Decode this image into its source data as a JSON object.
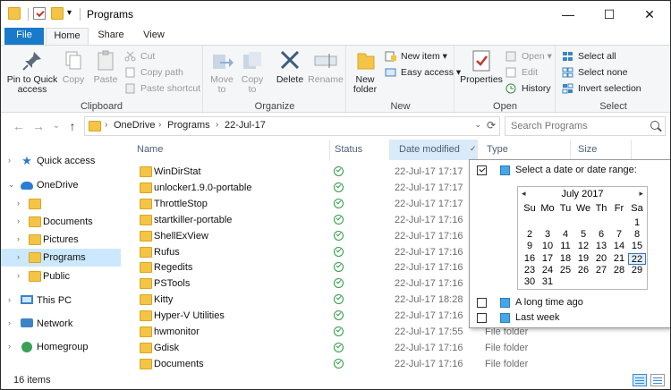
{
  "window": {
    "title": "Programs",
    "controls": {
      "minimize": "—",
      "maximize": "☐",
      "close": "✕"
    },
    "qa_dropdown": "▾"
  },
  "ribbon": {
    "tabs": [
      "File",
      "Home",
      "Share",
      "View"
    ],
    "clipboard": {
      "label": "Clipboard",
      "pin": "Pin to Quick access",
      "copy": "Copy",
      "paste": "Paste",
      "cut": "Cut",
      "copy_path": "Copy path",
      "paste_shortcut": "Paste shortcut"
    },
    "organize": {
      "label": "Organize",
      "move_to": "Move to",
      "copy_to": "Copy to",
      "delete": "Delete",
      "rename": "Rename"
    },
    "new": {
      "label": "New",
      "new_folder": "New folder",
      "new_item": "New item ▾",
      "easy_access": "Easy access ▾"
    },
    "open": {
      "label": "Open",
      "properties": "Properties",
      "open": "Open ▾",
      "edit": "Edit",
      "history": "History"
    },
    "select": {
      "label": "Select",
      "select_all": "Select all",
      "select_none": "Select none",
      "invert": "Invert selection"
    }
  },
  "address": {
    "crumbs": [
      "OneDrive",
      "Programs",
      "22-Jul-17"
    ],
    "back": "←",
    "forward": "→",
    "recent": "⌄",
    "up": "↑",
    "dropdown": "⌄",
    "refresh": "⟳",
    "chevron": "›"
  },
  "search": {
    "placeholder": "Search Programs"
  },
  "nav": {
    "items": [
      "Quick access",
      "OneDrive",
      "",
      "Documents",
      "Pictures",
      "Programs",
      "Public",
      "This PC",
      "Network",
      "Homegroup"
    ]
  },
  "columns": {
    "name": "Name",
    "status": "Status",
    "date": "Date modified",
    "type": "Type",
    "size": "Size",
    "sort_arrow": "✓"
  },
  "files": [
    {
      "name": "WinDirStat",
      "date": "22-Jul-17 17:17",
      "type": ""
    },
    {
      "name": "unlocker1.9.0-portable",
      "date": "22-Jul-17 17:17",
      "type": ""
    },
    {
      "name": "ThrottleStop",
      "date": "22-Jul-17 17:17",
      "type": ""
    },
    {
      "name": "startkiller-portable",
      "date": "22-Jul-17 17:16",
      "type": ""
    },
    {
      "name": "ShellExView",
      "date": "22-Jul-17 17:16",
      "type": ""
    },
    {
      "name": "Rufus",
      "date": "22-Jul-17 17:16",
      "type": ""
    },
    {
      "name": "Regedits",
      "date": "22-Jul-17 17:16",
      "type": ""
    },
    {
      "name": "PSTools",
      "date": "22-Jul-17 17:16",
      "type": ""
    },
    {
      "name": "Kitty",
      "date": "22-Jul-17 18:28",
      "type": ""
    },
    {
      "name": "Hyper-V Utilities",
      "date": "22-Jul-17 17:16",
      "type": ""
    },
    {
      "name": "hwmonitor",
      "date": "22-Jul-17 17:55",
      "type": "File folder"
    },
    {
      "name": "Gdisk",
      "date": "22-Jul-17 17:16",
      "type": "File folder"
    },
    {
      "name": "Documents",
      "date": "22-Jul-17 17:16",
      "type": "File folder"
    }
  ],
  "filter_popup": {
    "select_date": "Select a date or date range:",
    "month": "July 2017",
    "prev": "◂",
    "next": "▸",
    "weekdays": [
      "Su",
      "Mo",
      "Tu",
      "We",
      "Th",
      "Fr",
      "Sa"
    ],
    "weeks": [
      [
        "",
        "",
        "",
        "",
        "",
        "",
        "1"
      ],
      [
        "2",
        "3",
        "4",
        "5",
        "6",
        "7",
        "8"
      ],
      [
        "9",
        "10",
        "11",
        "12",
        "13",
        "14",
        "15"
      ],
      [
        "16",
        "17",
        "18",
        "19",
        "20",
        "21",
        "22"
      ],
      [
        "23",
        "24",
        "25",
        "26",
        "27",
        "28",
        "29"
      ],
      [
        "30",
        "31",
        "",
        "",
        "",
        "",
        ""
      ]
    ],
    "today": "22",
    "long_time_ago": "A long time ago",
    "last_week": "Last week"
  },
  "status": {
    "count": "16 items"
  },
  "colors": {
    "accent": "#1979ca",
    "selected": "#cce8ff",
    "folder": "#f3c445"
  }
}
